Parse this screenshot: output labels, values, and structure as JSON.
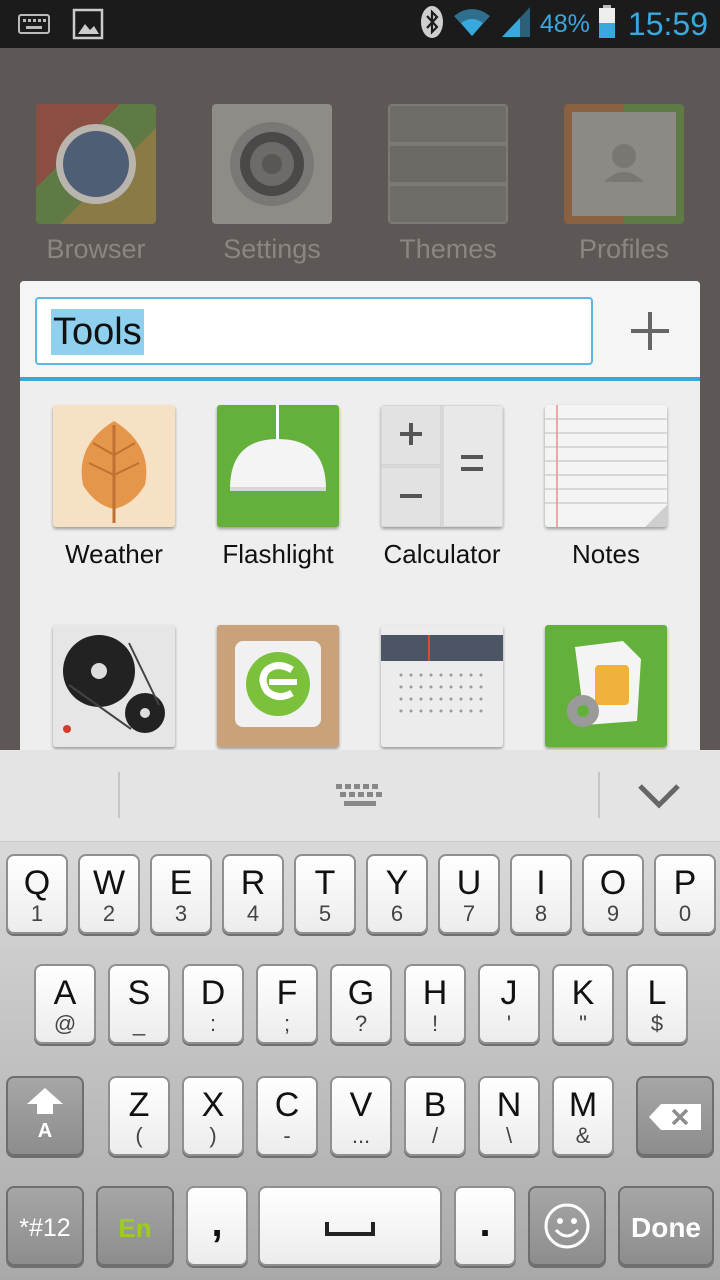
{
  "statusbar": {
    "icons": [
      "keyboard-icon",
      "image-icon",
      "bluetooth-icon",
      "wifi-icon",
      "signal-icon",
      "battery-icon"
    ],
    "battery": "48%",
    "time": "15:59",
    "accent": "#39a8dd"
  },
  "home": {
    "apps": [
      {
        "label": "Browser",
        "icon": "browser-icon"
      },
      {
        "label": "Settings",
        "icon": "settings-icon"
      },
      {
        "label": "Themes",
        "icon": "themes-icon"
      },
      {
        "label": "Profiles",
        "icon": "profiles-icon"
      }
    ]
  },
  "folder": {
    "name": "Tools",
    "add_icon": "plus-icon",
    "accent": "#33a9dc",
    "apps": [
      {
        "label": "Weather",
        "icon": "weather-icon"
      },
      {
        "label": "Flashlight",
        "icon": "flashlight-icon"
      },
      {
        "label": "Calculator",
        "icon": "calculator-icon"
      },
      {
        "label": "Notes",
        "icon": "notes-icon"
      },
      {
        "label": "",
        "icon": "recorder-icon"
      },
      {
        "label": "",
        "icon": "connect-icon"
      },
      {
        "label": "",
        "icon": "radio-icon"
      },
      {
        "label": "",
        "icon": "sim-toolkit-icon"
      }
    ]
  },
  "keyboard": {
    "bar_icons": [
      "keyboard-icon",
      "chevron-down-icon"
    ],
    "row1": [
      {
        "main": "Q",
        "sub": "1"
      },
      {
        "main": "W",
        "sub": "2"
      },
      {
        "main": "E",
        "sub": "3"
      },
      {
        "main": "R",
        "sub": "4"
      },
      {
        "main": "T",
        "sub": "5"
      },
      {
        "main": "Y",
        "sub": "6"
      },
      {
        "main": "U",
        "sub": "7"
      },
      {
        "main": "I",
        "sub": "8"
      },
      {
        "main": "O",
        "sub": "9"
      },
      {
        "main": "P",
        "sub": "0"
      }
    ],
    "row2": [
      {
        "main": "A",
        "sub": "@"
      },
      {
        "main": "S",
        "sub": "_"
      },
      {
        "main": "D",
        "sub": ":"
      },
      {
        "main": "F",
        "sub": ";"
      },
      {
        "main": "G",
        "sub": "?"
      },
      {
        "main": "H",
        "sub": "!"
      },
      {
        "main": "J",
        "sub": "'"
      },
      {
        "main": "K",
        "sub": "\""
      },
      {
        "main": "L",
        "sub": "$"
      }
    ],
    "row3": [
      {
        "main": "Z",
        "sub": "("
      },
      {
        "main": "X",
        "sub": ")"
      },
      {
        "main": "C",
        "sub": "-"
      },
      {
        "main": "V",
        "sub": "..."
      },
      {
        "main": "B",
        "sub": "/"
      },
      {
        "main": "N",
        "sub": "\\"
      },
      {
        "main": "M",
        "sub": "&"
      }
    ],
    "shift_label": "A",
    "symbols_label": "*#12",
    "lang_label": "En",
    "comma_label": ",",
    "period_label": ".",
    "done_label": "Done",
    "lang_color": "#9ccc20"
  }
}
